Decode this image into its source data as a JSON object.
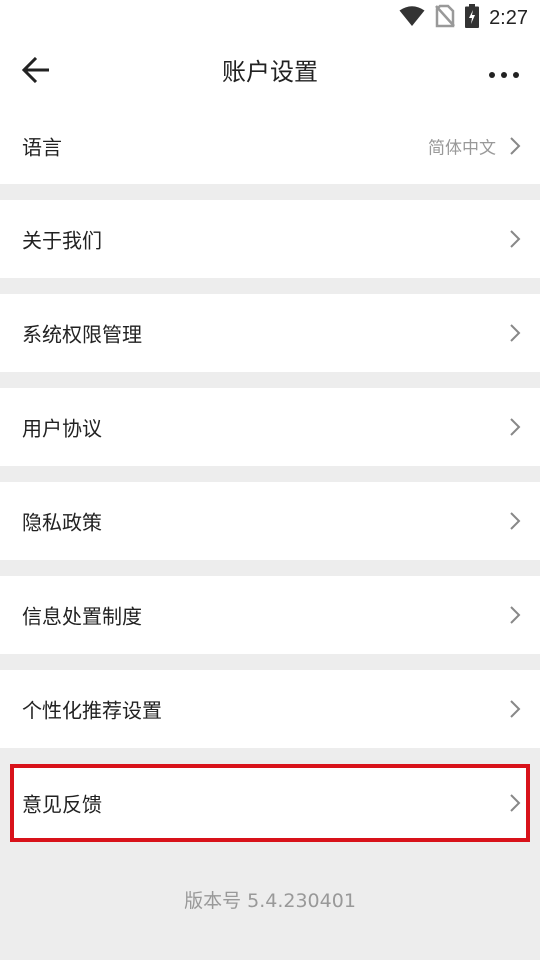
{
  "status_bar": {
    "time": "2:27",
    "icons": [
      "wifi-icon",
      "no-sim-icon",
      "battery-charging-icon"
    ]
  },
  "header": {
    "title": "账户设置",
    "back_icon": "arrow-left-icon",
    "more_icon": "more-horizontal-icon"
  },
  "settings": {
    "items": [
      {
        "label": "语言",
        "value": "简体中文"
      },
      {
        "label": "关于我们"
      },
      {
        "label": "系统权限管理"
      },
      {
        "label": "用户协议"
      },
      {
        "label": "隐私政策"
      },
      {
        "label": "信息处置制度"
      },
      {
        "label": "个性化推荐设置"
      },
      {
        "label": "意见反馈"
      }
    ]
  },
  "footer": {
    "version": "版本号 5.4.230401"
  },
  "colors": {
    "highlight_border": "#d8121a",
    "background": "#ededed",
    "text_primary": "#222222",
    "text_secondary": "#999999"
  }
}
